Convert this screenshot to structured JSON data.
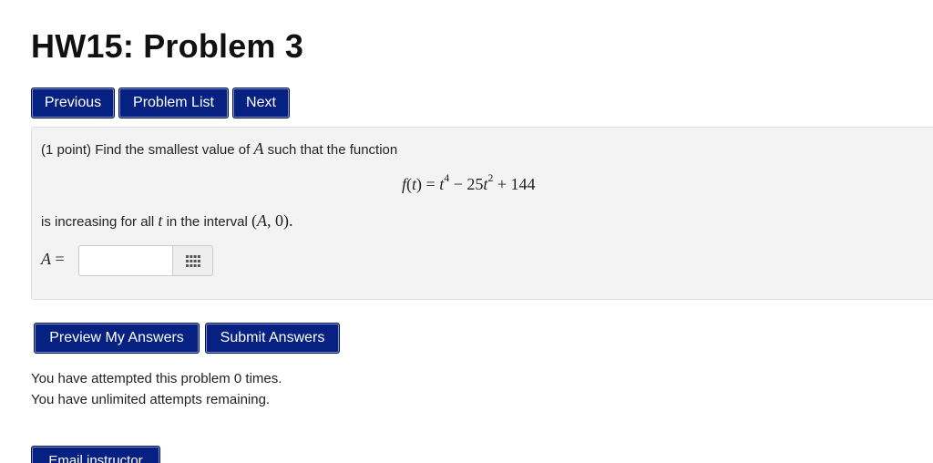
{
  "page": {
    "title": "HW15: Problem 3"
  },
  "nav": {
    "previous_label": "Previous",
    "problem_list_label": "Problem List",
    "next_label": "Next"
  },
  "problem": {
    "points": "(1 point)",
    "intro": "Find the smallest value of",
    "intro_var": "A",
    "intro_tail": "such that the function",
    "equation": {
      "lhs_fn": "f",
      "lhs_open": "(",
      "lhs_var": "t",
      "lhs_close": ")",
      "equals": "=",
      "term1_var": "t",
      "term1_exp": "4",
      "minus": "−",
      "term2_coef": "25",
      "term2_var": "t",
      "term2_exp": "2",
      "plus": "+",
      "constant": "144"
    },
    "condition_prefix": "is increasing for all",
    "condition_var": "t",
    "condition_mid": "in the interval",
    "interval_open": "(",
    "interval_var": "A",
    "interval_rest": ", 0).",
    "answer_var": "A",
    "answer_equals": "=",
    "answer_value": "",
    "answer_placeholder": ""
  },
  "actions": {
    "preview_label": "Preview My Answers",
    "submit_label": "Submit Answers"
  },
  "status": {
    "attempts": "You have attempted this problem 0 times.",
    "remaining": "You have unlimited attempts remaining."
  },
  "footer": {
    "email_label": "Email instructor"
  },
  "colors": {
    "button_bg": "#062181",
    "panel_bg": "#f3f3f3"
  },
  "icons": {
    "equation_editor": "grid-icon"
  }
}
